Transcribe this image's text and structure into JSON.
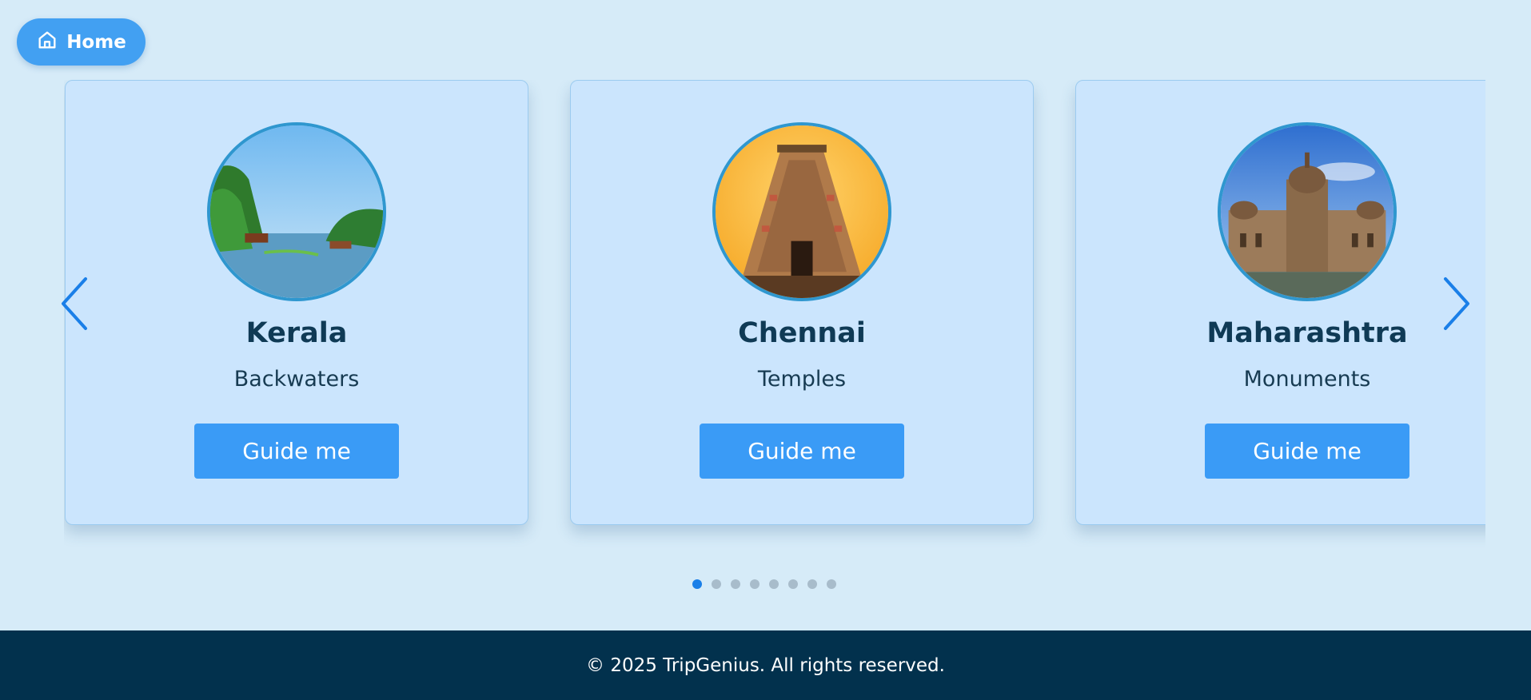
{
  "header": {
    "home_label": "Home",
    "home_icon": "home-icon"
  },
  "carousel": {
    "prev_icon": "chevron-left-icon",
    "next_icon": "chevron-right-icon",
    "cards": [
      {
        "title": "Kerala",
        "subtitle": "Backwaters",
        "button": "Guide me",
        "image": "kerala-backwaters-photo"
      },
      {
        "title": "Chennai",
        "subtitle": "Temples",
        "button": "Guide me",
        "image": "chennai-temple-photo"
      },
      {
        "title": "Maharashtra",
        "subtitle": "Monuments",
        "button": "Guide me",
        "image": "maharashtra-monument-photo"
      }
    ],
    "dots": {
      "count": 8,
      "active_index": 0
    }
  },
  "footer": {
    "text": "© 2025 TripGenius. All rights reserved."
  },
  "colors": {
    "page_bg": "#d6ebf8",
    "card_bg": "#cbe5fd",
    "accent": "#3a9bf6",
    "title": "#0f3a55",
    "footer_bg": "#02314d",
    "dot_active": "#1a7fe8",
    "dot_inactive": "#a8bccb"
  }
}
